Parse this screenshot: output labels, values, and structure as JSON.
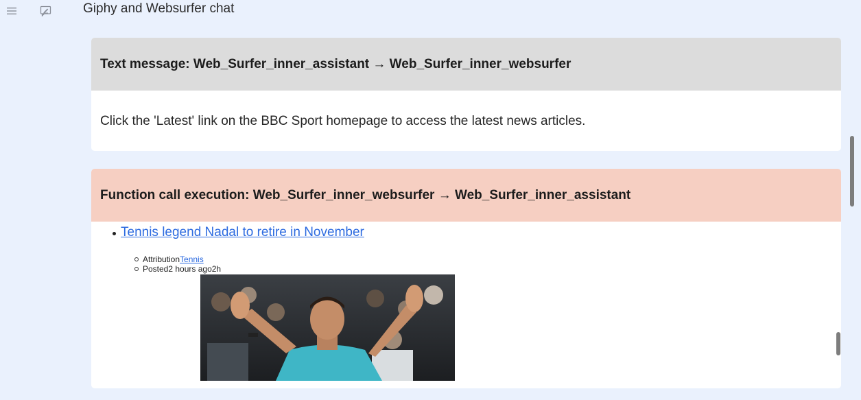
{
  "app": {
    "title": "Giphy and Websurfer chat",
    "icons": {
      "menu": "hamburger-menu-icon",
      "new_chat": "edit-chat-icon"
    }
  },
  "messages": [
    {
      "type": "Text message",
      "header": "Text message: Web_Surfer_inner_assistant → Web_Surfer_inner_websurfer",
      "body": "Click the 'Latest' link on the BBC Sport homepage to access the latest news articles.",
      "header_color": "#dcdcdc"
    },
    {
      "type": "Function call execution",
      "header": "Function call execution: Web_Surfer_inner_websurfer → Web_Surfer_inner_assistant",
      "header_color": "#f6cfc2",
      "article": {
        "link_text": "Tennis legend Nadal to retire in November",
        "attribution_label": "Attribution",
        "attribution_link": "Tennis",
        "posted_text": "Posted2 hours ago2h"
      }
    }
  ]
}
